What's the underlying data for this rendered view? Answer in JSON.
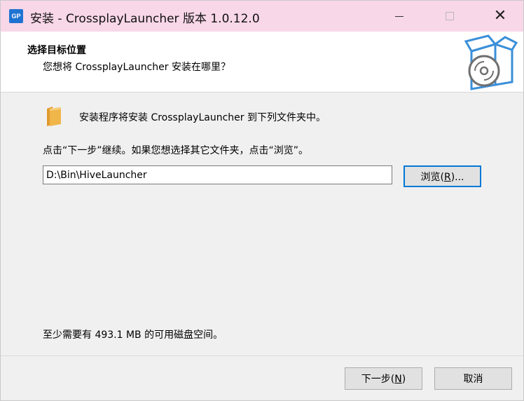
{
  "window": {
    "title": "安装 - CrossplayLauncher 版本 1.0.12.0",
    "app_icon_text": "GP",
    "controls": {
      "minimize": "minimize-icon",
      "maximize": "maximize-icon",
      "close": "✕"
    }
  },
  "header": {
    "title": "选择目标位置",
    "subtitle": "您想将 CrossplayLauncher 安装在哪里？",
    "icon": "install-box-cd-icon"
  },
  "main": {
    "folder_icon": "folder-icon",
    "intro": "安装程序将安装 CrossplayLauncher 到下列文件夹中。",
    "instruction": "点击“下一步”继续。如果您想选择其它文件夹，点击“浏览”。",
    "path_value": "D:\\Bin\\HiveLauncher",
    "browse_button": {
      "text": "浏览(",
      "key": "R",
      "suffix": ")..."
    },
    "disk_space": "至少需要有 493.1 MB 的可用磁盘空间。"
  },
  "footer": {
    "next_button": {
      "text": "下一步(",
      "key": "N",
      "suffix": ")"
    },
    "cancel_button": "取消"
  },
  "colors": {
    "titlebar": "#f8d7e8",
    "accent": "#0078d7",
    "app_icon": "#1e73d2",
    "folder": "#f0b64a",
    "box": "#3a8fd8"
  }
}
